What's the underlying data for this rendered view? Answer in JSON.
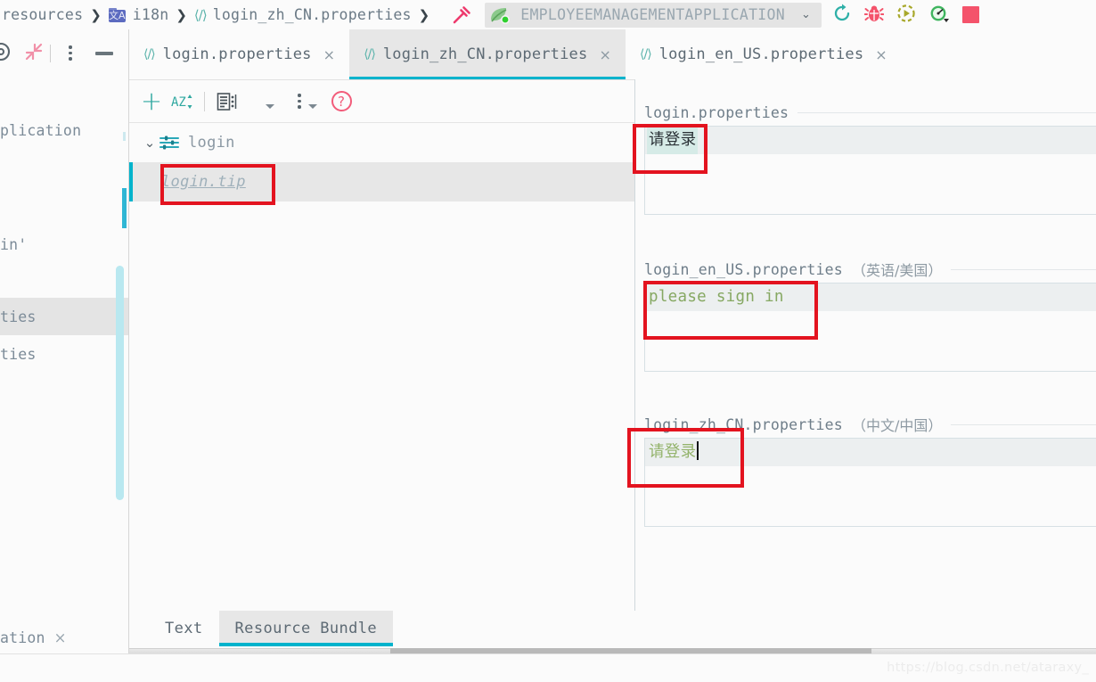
{
  "window": {
    "watermark": "https://blog.csdn.net/ataraxy_"
  },
  "breadcrumb": {
    "items": [
      {
        "label": "resources",
        "icon": "",
        "kind": "folder"
      },
      {
        "label": "i18n",
        "icon": "i18n-folder-icon",
        "kind": "folder"
      },
      {
        "label": "login_zh_CN.properties",
        "icon": "properties-file-icon",
        "kind": "file"
      }
    ],
    "separator": "❯"
  },
  "toolbar": {
    "build_icon": "hammer-icon",
    "run_config": {
      "name": "EMPLOYEEMANAGEMENTAPPLICATION",
      "icon": "spring-boot-leaf-icon",
      "dropdown": "⌄"
    },
    "actions": [
      {
        "name": "rerun-icon",
        "label": "Rerun",
        "color": "#2fb0a8"
      },
      {
        "name": "debug-bug-icon",
        "label": "Debug",
        "color": "#f4536b"
      },
      {
        "name": "run-with-coverage-icon",
        "label": "Run with Coverage",
        "color": "#a8a82b"
      },
      {
        "name": "profiler-icon",
        "label": "Profiler",
        "color": "#3fb55f"
      },
      {
        "name": "stop-icon",
        "label": "Stop",
        "color": "#f4536b"
      }
    ]
  },
  "left_panel": {
    "toolbar": [
      {
        "name": "collapse-all-icon",
        "label": "Collapse All"
      },
      {
        "name": "options-icon",
        "label": "Options"
      },
      {
        "name": "hide-icon",
        "label": "Hide"
      }
    ],
    "rows": [
      {
        "label": "plication",
        "selected": false
      },
      {
        "label": "",
        "selected": false
      },
      {
        "label": "in'",
        "selected": false
      },
      {
        "label": "ties",
        "selected": true
      },
      {
        "label": "ties",
        "selected": false
      }
    ],
    "bottom_tab": {
      "label": "ation",
      "close": "×"
    }
  },
  "editor_tabs": {
    "items": [
      {
        "label": "login.properties",
        "icon": "properties-file-icon",
        "active": false,
        "close": "×"
      },
      {
        "label": "login_zh_CN.properties",
        "icon": "properties-file-icon",
        "active": true,
        "close": "×"
      },
      {
        "label": "login_en_US.properties",
        "icon": "properties-file-icon",
        "active": false,
        "close": "×"
      }
    ]
  },
  "resource_bundle": {
    "toolbar": [
      {
        "name": "add-property-icon",
        "label": "+"
      },
      {
        "name": "sort-alphabetically-icon",
        "label": "AZ"
      },
      {
        "name": "group-by-prefix-icon",
        "label": "Group"
      },
      {
        "name": "more-options-icon",
        "label": "More"
      },
      {
        "name": "help-icon",
        "label": "?"
      }
    ],
    "tree": {
      "group": {
        "label": "login",
        "expanded": true,
        "twisty": "⌄",
        "icon": "resource-bundle-icon"
      },
      "leaf": {
        "label": "login.tip",
        "selected": true
      }
    }
  },
  "bottom_tabs": {
    "items": [
      {
        "label": "Text",
        "active": false
      },
      {
        "label": "Resource Bundle",
        "active": true
      }
    ]
  },
  "translation_editors": [
    {
      "file": "login.properties",
      "locale": "",
      "value": "请登录",
      "value_style": "selected-default",
      "has_caret": false,
      "annotated": true
    },
    {
      "file": "login_en_US.properties",
      "locale": "（英语/美国）",
      "value": "please sign in",
      "value_style": "green",
      "has_caret": false,
      "annotated": true
    },
    {
      "file": "login_zh_CN.properties",
      "locale": "（中文/中国）",
      "value": "请登录",
      "value_style": "green",
      "has_caret": true,
      "annotated": true
    }
  ],
  "colors": {
    "accent_teal": "#00b3cc",
    "annotation_red": "#e3131f",
    "green_string": "#86a862",
    "selection_cn": "#d6ebe7"
  }
}
